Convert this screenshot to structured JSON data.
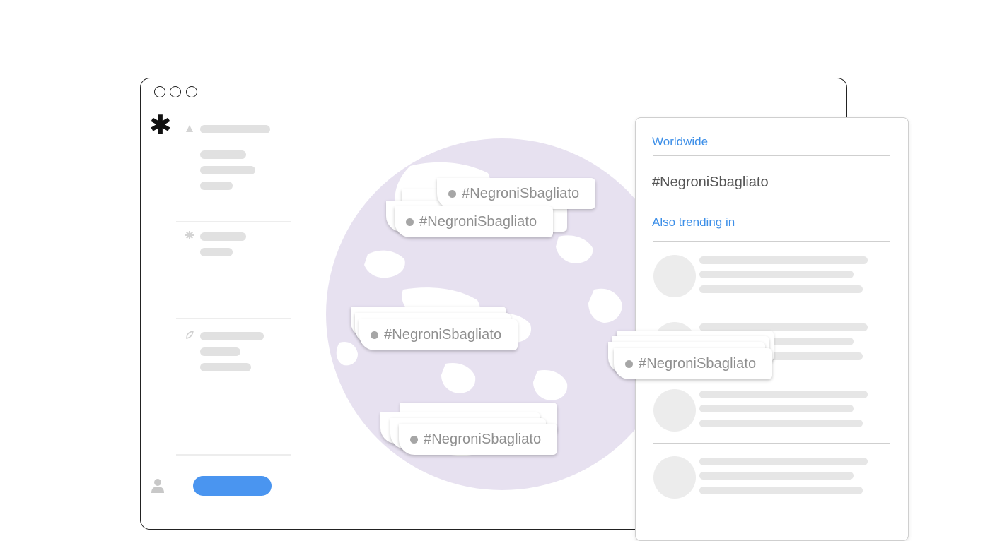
{
  "trend_tag": "#NegroniSbagliato",
  "panel": {
    "scope_label": "Worldwide",
    "trend_title": "#NegroniSbagliato",
    "also_label": "Also trending in"
  },
  "icons": {
    "logo": "asterisk-icon",
    "user": "user-icon"
  },
  "colors": {
    "accent": "#4a95f0",
    "link": "#3d8fe8",
    "globe": "#e6e0f0",
    "skeleton": "#e1e1e1"
  }
}
